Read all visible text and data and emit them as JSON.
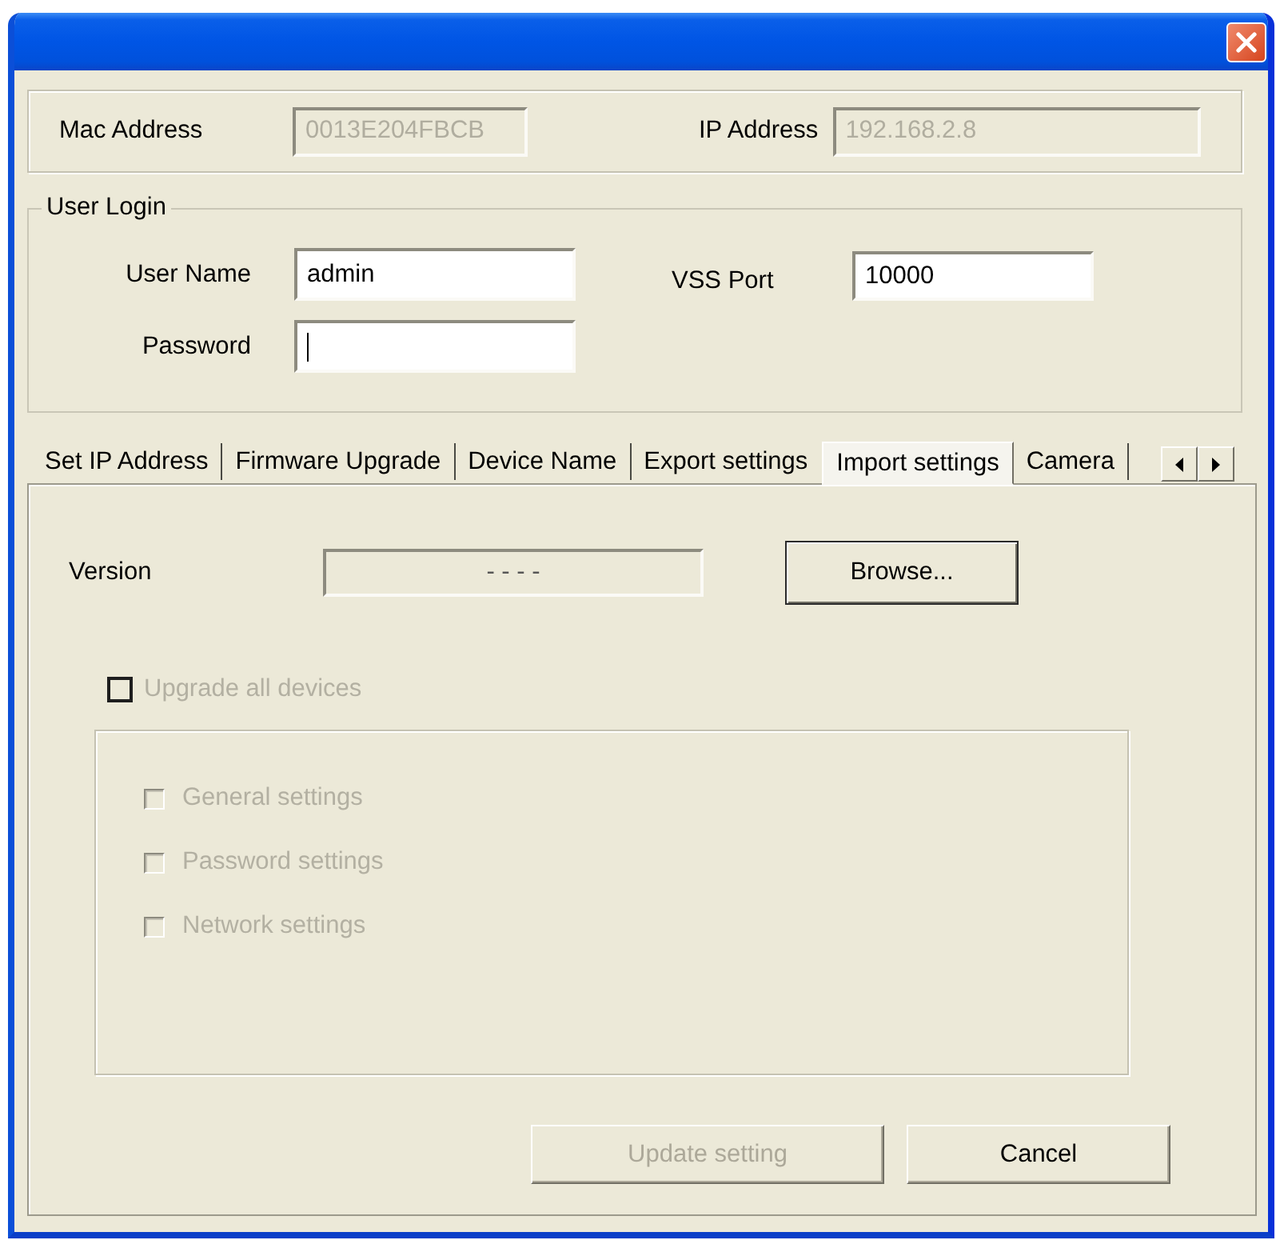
{
  "device": {
    "fields": [
      {
        "label": "Mac Address",
        "value": "0013E204FBCB",
        "disabled": true
      },
      {
        "label": "IP Address",
        "value": "192.168.2.8",
        "disabled": true
      }
    ]
  },
  "user_login": {
    "title": "User Login",
    "fields": [
      {
        "label": "User Name",
        "value": "admin",
        "focused": false
      },
      {
        "label": "Password",
        "focused": true
      }
    ],
    "port": {
      "label": "VSS Port",
      "value": "10000",
      "focused": false
    }
  },
  "tabs": [
    {
      "label": "Set IP Address",
      "selected": false
    },
    {
      "label": "Firmware Upgrade",
      "selected": false
    },
    {
      "label": "Device Name",
      "selected": false
    },
    {
      "label": "Export settings",
      "selected": false
    },
    {
      "label": "Import settings",
      "selected": true
    },
    {
      "label": "Camera",
      "selected": false
    }
  ],
  "import_settings": {
    "version": {
      "label": "Version",
      "value": "- - - -"
    },
    "browse_button": {
      "label": "Browse...",
      "default": true
    },
    "upgrade_all": {
      "label": "Upgrade all devices",
      "checked": false,
      "disabled": true
    },
    "options": [
      {
        "label": "General settings",
        "checked": false,
        "disabled": true
      },
      {
        "label": "Password settings",
        "checked": false,
        "disabled": true
      },
      {
        "label": "Network settings",
        "checked": false,
        "disabled": true
      }
    ],
    "buttons": [
      {
        "label": "Update setting",
        "disabled": true,
        "default": false
      },
      {
        "label": "Cancel",
        "disabled": false,
        "default": false
      }
    ]
  }
}
